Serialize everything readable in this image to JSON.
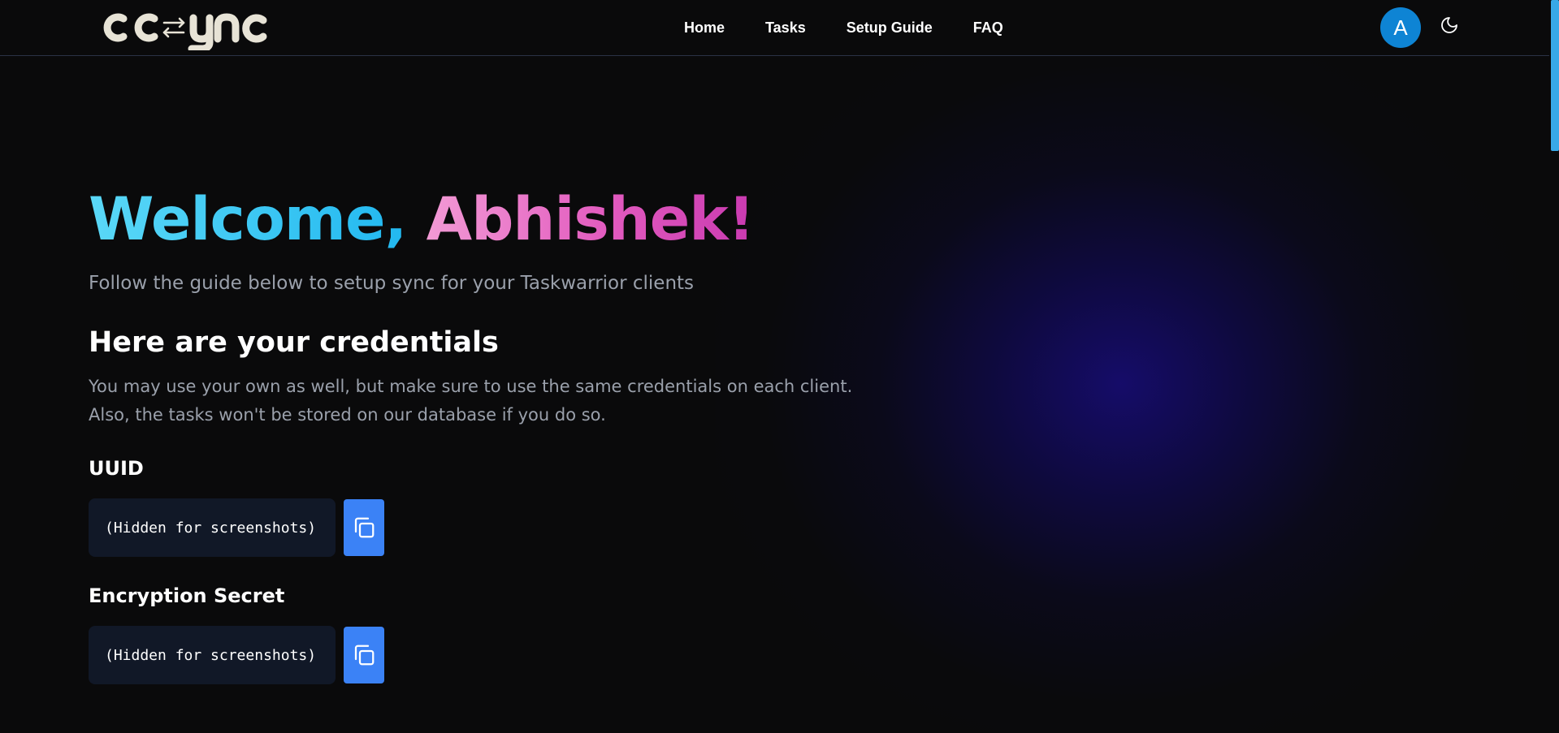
{
  "header": {
    "logo_text": "ccsync",
    "nav": [
      {
        "label": "Home"
      },
      {
        "label": "Tasks"
      },
      {
        "label": "Setup Guide"
      },
      {
        "label": "FAQ"
      }
    ],
    "avatar_initial": "A",
    "theme_toggle_icon": "moon-icon"
  },
  "hero": {
    "welcome_prefix": "Welcome,",
    "welcome_name": "Abhishek!",
    "subtitle": "Follow the guide below to setup sync for your Taskwarrior clients"
  },
  "credentials": {
    "heading": "Here are your credentials",
    "description_line1": "You may use your own as well, but make sure to use the same credentials on each client.",
    "description_line2": "Also, the tasks won't be stored on our database if you do so.",
    "fields": [
      {
        "label": "UUID",
        "value": "(Hidden for screenshots)",
        "copy_icon": "copy-icon"
      },
      {
        "label": "Encryption Secret",
        "value": "(Hidden for screenshots)",
        "copy_icon": "copy-icon"
      }
    ]
  },
  "colors": {
    "background": "#0a0a0b",
    "accent_blue": "#3b82f6",
    "avatar_blue": "#0e84d4",
    "gradient_cyan": "#22b8f0",
    "gradient_pink": "#e25bbf",
    "muted_text": "#9aa0ab",
    "code_box_bg": "#111827",
    "scrollbar_thumb": "#38a8e8"
  }
}
